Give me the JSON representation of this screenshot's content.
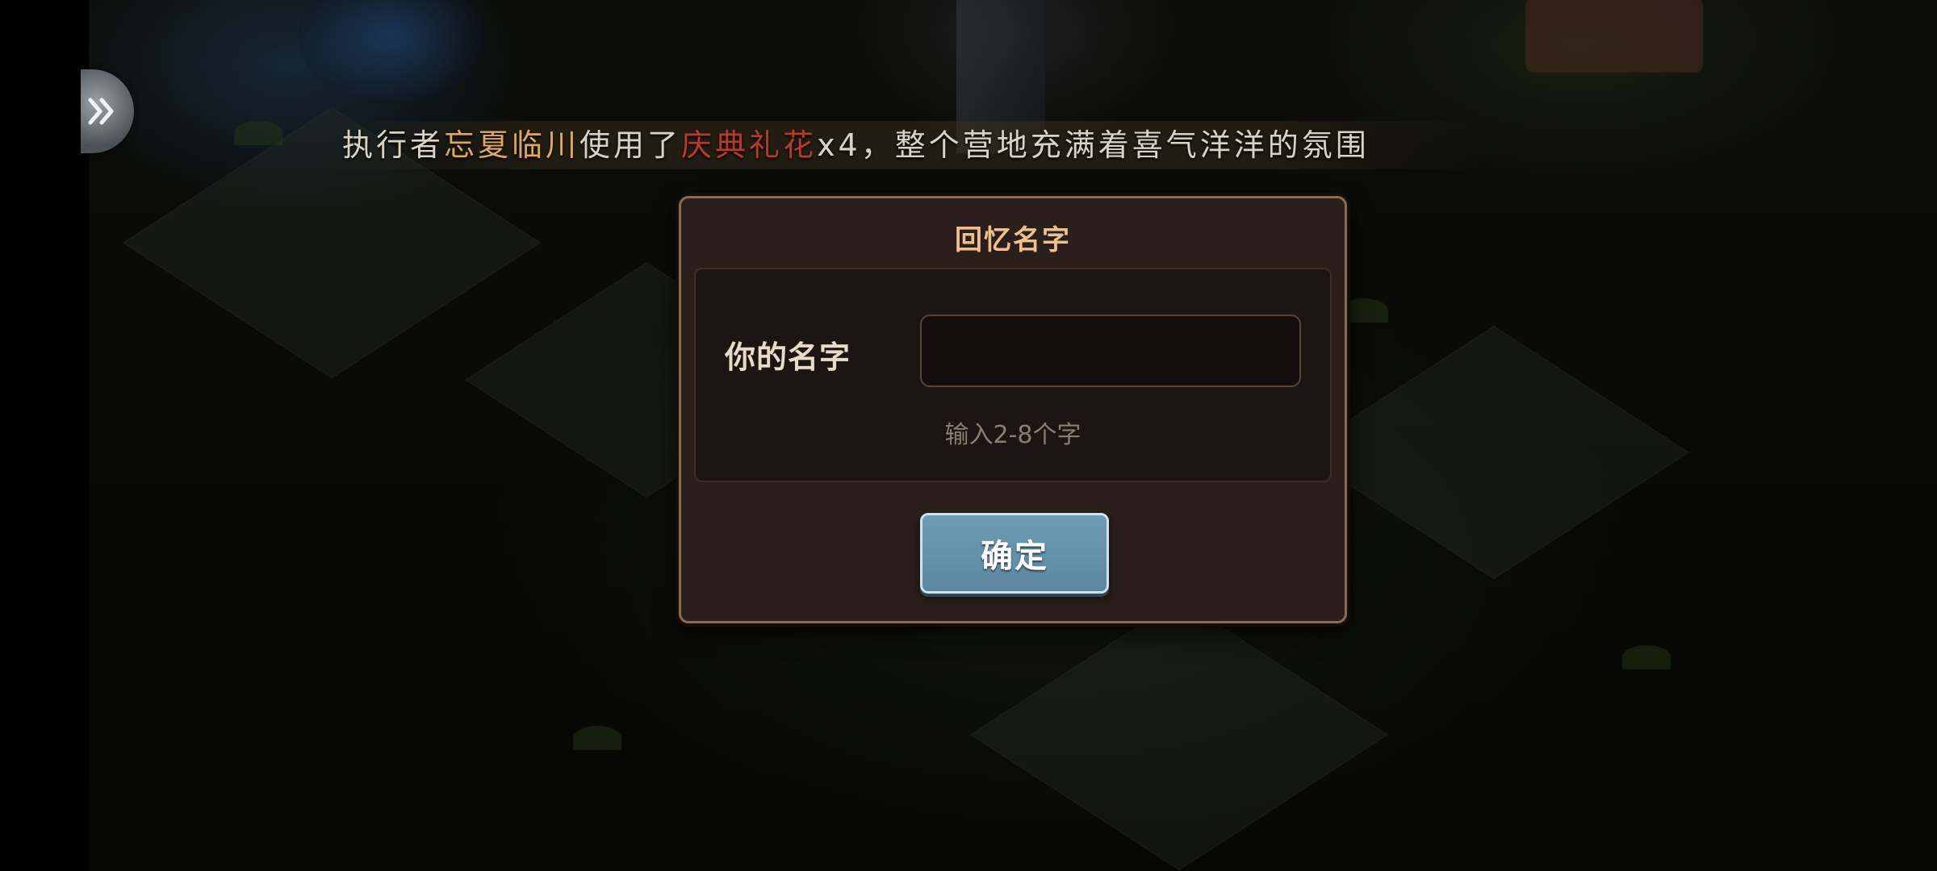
{
  "announcement": {
    "prefix": "执行者",
    "player_name": "忘夏临川",
    "middle": "使用了",
    "item_name": "庆典礼花",
    "suffix": "x4，整个营地充满着喜气洋洋的氛围"
  },
  "dialog": {
    "title": "回忆名字",
    "name_label": "你的名字",
    "name_input_value": "",
    "name_input_placeholder": "",
    "hint": "输入2-8个字",
    "confirm_label": "确定"
  },
  "side_button": {
    "icon": "double-chevron-right-icon"
  },
  "colors": {
    "announcement_text": "#d9d3c4",
    "player_name_highlight": "#e0a95a",
    "item_highlight": "#b9392b",
    "dialog_title": "#f0c08a",
    "confirm_button": "#6e9cb2"
  }
}
